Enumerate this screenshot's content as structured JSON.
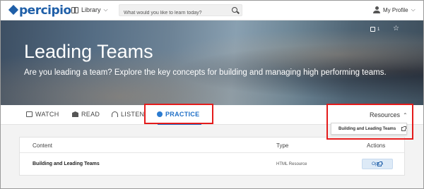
{
  "header": {
    "logo_text": "percipio",
    "library_label": "Library",
    "search_placeholder": "What would you like to learn today?",
    "profile_label": "My Profile"
  },
  "hero": {
    "title": "Leading Teams",
    "subtitle": "Are you leading a team?  Explore the key concepts for building and managing high performing teams.",
    "like_count": "1"
  },
  "tabs": [
    {
      "label": "WATCH",
      "icon": "video-icon"
    },
    {
      "label": "READ",
      "icon": "book-icon"
    },
    {
      "label": "LISTEN",
      "icon": "headphones-icon"
    },
    {
      "label": "PRACTICE",
      "icon": "globe-icon",
      "active": true
    }
  ],
  "resources": {
    "label": "Resources",
    "menu_item": "Building and Leading Teams"
  },
  "table": {
    "columns": [
      "Content",
      "Type",
      "Actions"
    ],
    "rows": [
      {
        "content": "Building and Leading Teams",
        "type": "HTML Resource",
        "action": "Open"
      }
    ]
  },
  "colors": {
    "brand": "#1f5fa8",
    "active_tab": "#1f6fc6",
    "highlight_box": "#e41b1b"
  }
}
